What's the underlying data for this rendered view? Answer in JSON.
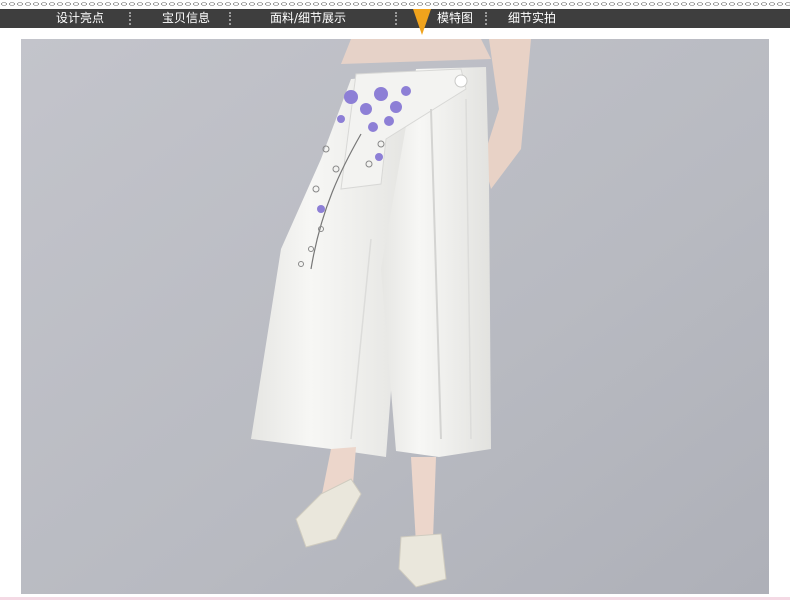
{
  "nav": {
    "items": [
      {
        "label": "设计亮点"
      },
      {
        "label": "宝贝信息"
      },
      {
        "label": "面料/细节展示"
      },
      {
        "label": "模特图"
      },
      {
        "label": "细节实拍"
      }
    ],
    "active_index": 3
  },
  "photo": {
    "icon": "product-photo-icon"
  },
  "colors": {
    "nav_bg": "#3e3e3e",
    "nav_text": "#ffffff",
    "active_marker": "#f0a31c",
    "photo_bg": "#bdbfc6",
    "trousers": "#f5f5f3",
    "embroidery": "#8d7fd6"
  }
}
